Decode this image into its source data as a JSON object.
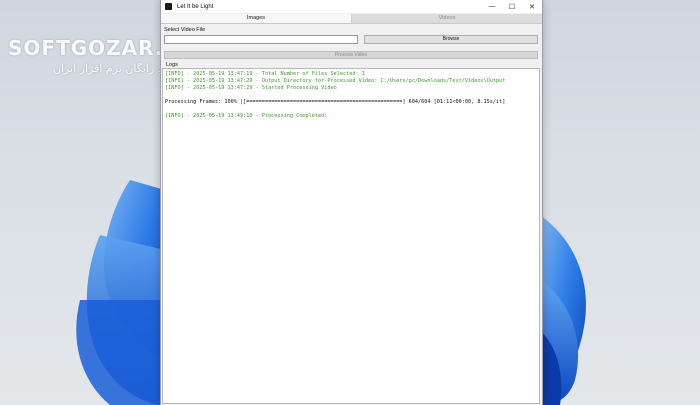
{
  "window": {
    "title": "Let It be Light",
    "controls": {
      "minimize": "—",
      "maximize": "☐",
      "close": "✕"
    }
  },
  "tabs": [
    {
      "label": "Images",
      "active": true
    },
    {
      "label": "Videos",
      "active": false
    }
  ],
  "form": {
    "select_label": "Select Video File",
    "file_value": "",
    "browse_label": "Browse",
    "process_label": "Process Video"
  },
  "logs": {
    "label": "Logs",
    "lines": [
      {
        "kind": "info",
        "text": "[INFO] - 2025-05-19 13:47:19 - Total Number of Files Selected: 1"
      },
      {
        "kind": "info",
        "text": "[INFO] - 2025-05-19 13:47:29 - Output Directory for Processed Video: C:/Users/pc/Downloads/Test/Videos\\Output"
      },
      {
        "kind": "info",
        "text": "[INFO] - 2025-05-19 13:47:29 - Started Processing Video"
      },
      {
        "kind": "blank",
        "text": ""
      },
      {
        "kind": "progress",
        "text": "Processing Frames: 100% |[==================================================] 604/604 [01:11<00:00, 8.15s/it]"
      },
      {
        "kind": "blank",
        "text": ""
      },
      {
        "kind": "info",
        "text": "[INFO] - 2025-05-19 13:49:10 - Processing Completed!"
      }
    ]
  },
  "watermark": {
    "brand": "SOFTGOZAR.COM",
    "subtitle": "دانلود رایگان نرم افزار ایران"
  },
  "colors": {
    "log_info": "#3f9a2e",
    "desktop_bloom": "#1f6fe0"
  }
}
